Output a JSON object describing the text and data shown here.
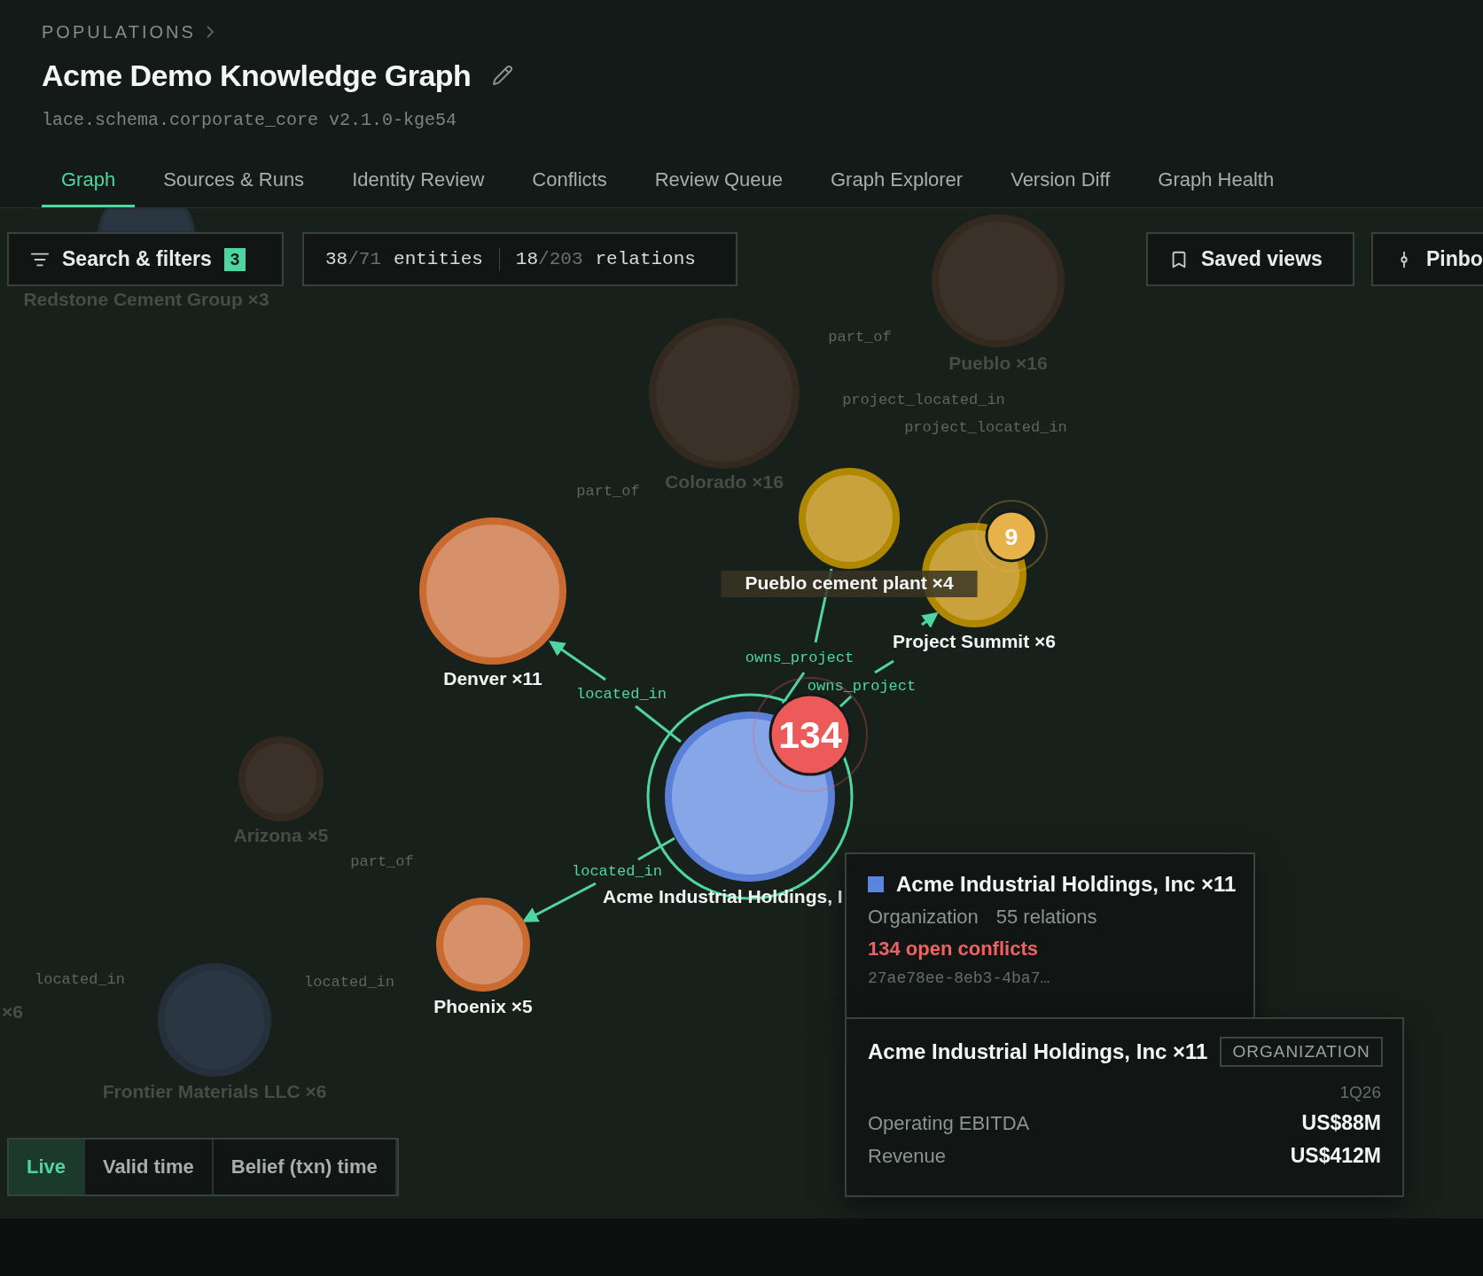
{
  "breadcrumb": "POPULATIONS",
  "title": "Acme Demo Knowledge Graph",
  "schema": "lace.schema.corporate_core v2.1.0-kge54",
  "tabs": [
    {
      "label": "Graph",
      "selected": true
    },
    {
      "label": "Sources & Runs",
      "selected": false
    },
    {
      "label": "Identity Review",
      "selected": false
    },
    {
      "label": "Conflicts",
      "selected": false
    },
    {
      "label": "Review Queue",
      "selected": false
    },
    {
      "label": "Graph Explorer",
      "selected": false
    },
    {
      "label": "Version Diff",
      "selected": false
    },
    {
      "label": "Graph Health",
      "selected": false
    }
  ],
  "toolbar": {
    "search_label": "Search & filters",
    "filter_count": "3",
    "entities": {
      "shown": "38",
      "total": "/71",
      "label": "entities"
    },
    "relations": {
      "shown": "18",
      "total": "/203",
      "label": "relations"
    },
    "saved_views": "Saved views",
    "pinboard": "Pinbo"
  },
  "graph": {
    "nodes": [
      {
        "label": "Redstone Cement Group ×3",
        "kind": "organization",
        "faded": true,
        "selected": false
      },
      {
        "label": "Pueblo ×16",
        "kind": "location",
        "faded": true,
        "selected": false
      },
      {
        "label": "Colorado ×16",
        "kind": "location",
        "faded": true,
        "selected": false
      },
      {
        "label": "Pueblo cement plant ×4",
        "kind": "project",
        "faded": false,
        "selected": false,
        "label_backdrop": true
      },
      {
        "label": "Project Summit ×6",
        "kind": "project",
        "faded": false,
        "selected": false,
        "badge": {
          "text": "9",
          "color": "#e8b24a"
        }
      },
      {
        "label": "Denver ×11",
        "kind": "location",
        "faded": false,
        "selected": false
      },
      {
        "label": "Acme Industrial Holdings, I",
        "kind": "organization",
        "faded": false,
        "selected": true,
        "badge": {
          "text": "134",
          "color": "#ec5a5a"
        }
      },
      {
        "label": "Phoenix ×5",
        "kind": "location",
        "faded": false,
        "selected": false
      },
      {
        "label": "Arizona ×5",
        "kind": "location",
        "faded": true,
        "selected": false
      },
      {
        "label": "Frontier Materials LLC ×6",
        "kind": "organization",
        "faded": true,
        "selected": false
      }
    ],
    "cut_labels": [
      "×6"
    ],
    "edges": [
      {
        "label": "part_of",
        "faded": true
      },
      {
        "label": "project_located_in",
        "faded": true
      },
      {
        "label": "project_located_in",
        "faded": true
      },
      {
        "label": "part_of",
        "faded": true
      },
      {
        "label": "owns_project",
        "faded": false
      },
      {
        "label": "owns_project",
        "faded": false
      },
      {
        "label": "located_in",
        "faded": false
      },
      {
        "label": "located_in",
        "faded": false
      },
      {
        "label": "part_of",
        "faded": true
      },
      {
        "label": "located_in",
        "faded": true
      },
      {
        "label": "located_in",
        "faded": true
      }
    ]
  },
  "time_modes": [
    {
      "label": "Live",
      "selected": true
    },
    {
      "label": "Valid time",
      "selected": false
    },
    {
      "label": "Belief (txn) time",
      "selected": false
    }
  ],
  "hover_card": {
    "title": "Acme Industrial Holdings, Inc ×11",
    "type": "Organization",
    "relations": "55 relations",
    "conflicts": "134 open conflicts",
    "id": "27ae78ee-8eb3-4ba7…"
  },
  "detail_card": {
    "title": "Acme Industrial Holdings, Inc ×11",
    "type_badge": "ORGANIZATION",
    "period": "1Q26",
    "metrics": [
      {
        "label": "Operating EBITDA",
        "value": "US$88M"
      },
      {
        "label": "Revenue",
        "value": "US$412M"
      }
    ]
  }
}
